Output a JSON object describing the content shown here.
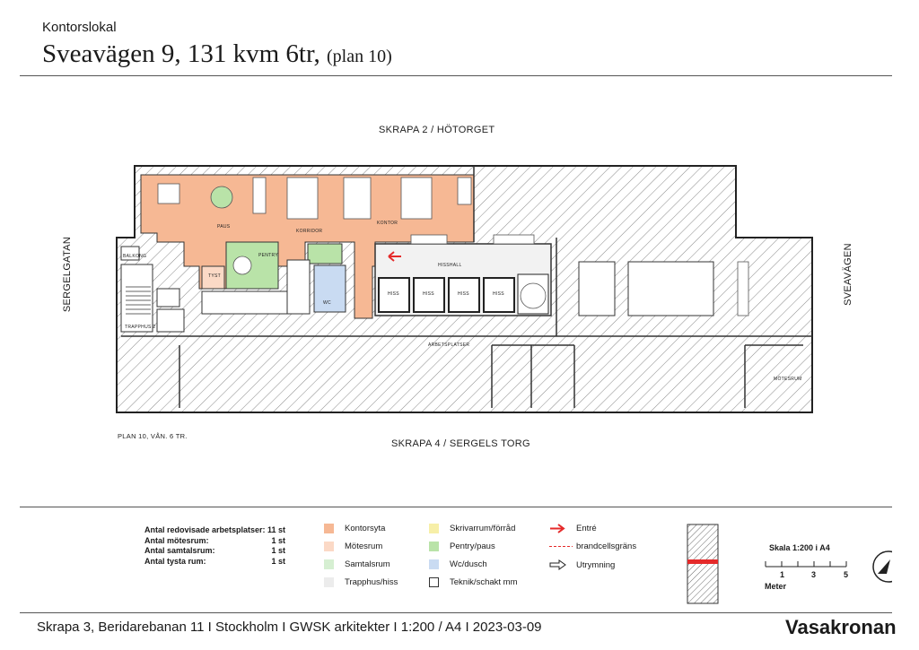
{
  "header": {
    "subtitle": "Kontorslokal",
    "title": "Sveavägen 9, 131 kvm 6tr,",
    "title_suffix": "(plan 10)"
  },
  "plan": {
    "north_label": "SKRAPA 2 / HÖTORGET",
    "south_label": "SKRAPA 4 / SERGELS TORG",
    "west_label": "SERGELGATAN",
    "east_label": "SVEAVÄGEN",
    "plan_caption": "PLAN 10, VÅN. 6 TR.",
    "rooms": {
      "pentry": "PENTRY",
      "korridor": "KORRIDOR",
      "paus": "PAUS",
      "kontor": "KONTOR",
      "hisshall": "HISSHALL",
      "tyst": "TYST",
      "wc": "WC",
      "balkong": "BALKONG",
      "trapphus": "TRAPPHUS 2",
      "arbetsplatser": "ARBETSPLATSER",
      "motesrum": "MÖTESRUM",
      "hiss_a": "HISS",
      "hiss_b": "HISS",
      "hiss_c": "HISS",
      "hiss_d": "HISS"
    }
  },
  "stats": [
    {
      "label": "Antal redovisade arbetsplatser:",
      "value": "11 st"
    },
    {
      "label": "Antal mötesrum:",
      "value": "1 st"
    },
    {
      "label": "Antal samtalsrum:",
      "value": "1 st"
    },
    {
      "label": "Antal tysta rum:",
      "value": "1 st"
    }
  ],
  "legend": {
    "kontorsyta": {
      "label": "Kontorsyta",
      "color": "#f6b894"
    },
    "motesrum": {
      "label": "Mötesrum",
      "color": "#fbd9c6"
    },
    "samtalsrum": {
      "label": "Samtalsrum",
      "color": "#d6efd2"
    },
    "trapphus": {
      "label": "Trapphus/hiss",
      "color": "#ececec"
    },
    "skrivarrum": {
      "label": "Skrivarrum/förråd",
      "color": "#f7efa8"
    },
    "pentry": {
      "label": "Pentry/paus",
      "color": "#b9e3a8"
    },
    "wc": {
      "label": "Wc/dusch",
      "color": "#c9dbf2"
    },
    "teknik": {
      "label": "Teknik/schakt mm",
      "color": "#ffffff"
    },
    "entre": {
      "label": "Entré",
      "color": "#e52a2a"
    },
    "brandcell": {
      "label": "brandcellsgräns",
      "color": "#e52a2a"
    },
    "utrymning": {
      "label": "Utrymning"
    }
  },
  "scale": {
    "title": "Skala 1:200 i A4",
    "ticks": [
      "1",
      "3",
      "5"
    ],
    "unit": "Meter"
  },
  "footer": {
    "text": "Skrapa 3, Beridarebanan 11 I  Stockholm  I  GWSK arkitekter  I  1:200 / A4 I  2023-03-09",
    "brand": "Vasakronan"
  }
}
